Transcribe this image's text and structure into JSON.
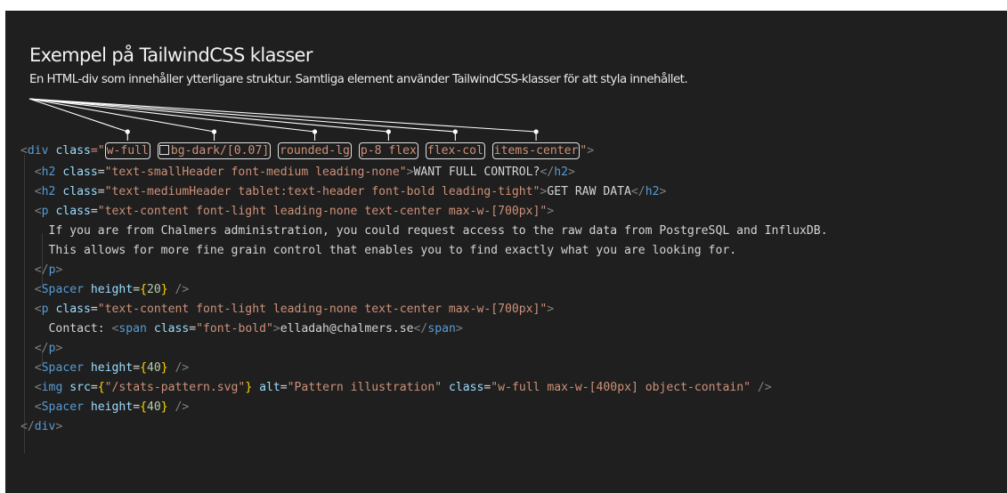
{
  "heading": {
    "title": "Exempel på TailwindCSS klasser",
    "subtitle": "En HTML-div som innehåller ytterligare struktur. Samtliga element använder TailwindCSS-klasser för att styla innehållet."
  },
  "code": {
    "div_open": {
      "lt": "<",
      "tag": "div",
      "attr": "class",
      "eq_quote": "=\"",
      "close_quote": "\"",
      "gt": ">"
    },
    "classes": [
      "w-full",
      "bg-dark/[0.07]",
      "rounded-lg",
      "p-8 flex",
      "flex-col",
      "items-center"
    ],
    "bg_swatch_icon": "square-outline-icon",
    "h2_a": {
      "lt": "<",
      "tag": "h2",
      "attr": "class",
      "eq": "=",
      "value": "\"text-smallHeader font-medium leading-none\"",
      "gt": ">",
      "text": "WANT FULL CONTROL?",
      "close_lt": "</",
      "close_tag": "h2",
      "close_gt": ">"
    },
    "h2_b": {
      "lt": "<",
      "tag": "h2",
      "attr": "class",
      "eq": "=",
      "value": "\"text-mediumHeader tablet:text-header font-bold leading-tight\"",
      "gt": ">",
      "text": "GET RAW DATA",
      "close_lt": "</",
      "close_tag": "h2",
      "close_gt": ">"
    },
    "p_a": {
      "lt": "<",
      "tag": "p",
      "attr": "class",
      "eq": "=",
      "value": "\"text-content font-light leading-none text-center max-w-[700px]\"",
      "gt": ">"
    },
    "p_a_line1": "If you are from Chalmers administration, you could request access to the raw data from PostgreSQL and InfluxDB.",
    "p_a_line2": "This allows for more fine grain control that enables you to find exactly what you are looking for.",
    "p_close": {
      "lt": "</",
      "tag": "p",
      "gt": ">"
    },
    "spacer20": {
      "lt": "<",
      "tag": "Spacer",
      "attr": "height",
      "eq": "=",
      "open": "{",
      "value": "20",
      "close": "}",
      "end": " />"
    },
    "p_b": {
      "lt": "<",
      "tag": "p",
      "attr": "class",
      "eq": "=",
      "value": "\"text-content font-light leading-none text-center max-w-[700px]\"",
      "gt": ">"
    },
    "contact": {
      "label": "Contact: ",
      "lt": "<",
      "tag": "span",
      "attr": "class",
      "eq": "=",
      "value": "\"font-bold\"",
      "gt": ">",
      "text": "elladah@chalmers.se",
      "close_lt": "</",
      "close_tag": "span",
      "close_gt": ">"
    },
    "p_close_b": {
      "lt": "</",
      "tag": "p",
      "gt": ">"
    },
    "spacer40a": {
      "lt": "<",
      "tag": "Spacer",
      "attr": "height",
      "eq": "=",
      "open": "{",
      "value": "40",
      "close": "}",
      "end": " />"
    },
    "img": {
      "lt": "<",
      "tag": "img",
      "src_attr": "src",
      "eq": "=",
      "src_open": "{",
      "src_value": "\"/stats-pattern.svg\"",
      "src_close": "}",
      "alt_attr": "alt",
      "alt_value": "\"Pattern illustration\"",
      "class_attr": "class",
      "class_value": "\"w-full max-w-[400px] object-contain\"",
      "end": " />"
    },
    "spacer40b": {
      "lt": "<",
      "tag": "Spacer",
      "attr": "height",
      "eq": "=",
      "open": "{",
      "value": "40",
      "close": "}",
      "end": " />"
    },
    "div_close": {
      "lt": "</",
      "tag": "div",
      "gt": ">"
    }
  },
  "colors": {
    "background": "#1f1f1f",
    "tag": "#569cd6",
    "attribute": "#9cdcfe",
    "string": "#ce9178",
    "brace": "#ffd700",
    "number": "#b5cea8",
    "text": "#d4d4d4",
    "annotation": "#ffffff"
  }
}
